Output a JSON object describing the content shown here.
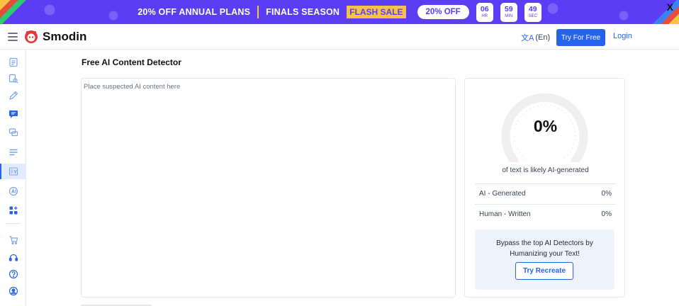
{
  "promo": {
    "headline": "20% OFF ANNUAL PLANS",
    "season": "FINALS SEASON",
    "flash": "FLASH SALE",
    "discount": "20% OFF",
    "timers": [
      {
        "value": "06",
        "unit": "HR"
      },
      {
        "value": "59",
        "unit": "MIN"
      },
      {
        "value": "49",
        "unit": "SEC"
      }
    ],
    "close": "X",
    "colors": {
      "background": "#5b3df5",
      "accent": "#f6c344"
    }
  },
  "header": {
    "brand": "Smodin",
    "language": "(En)",
    "try_free": "Try For Free",
    "login": "Login"
  },
  "sidebar": {
    "items": [
      {
        "icon": "document-check-icon"
      },
      {
        "icon": "document-search-icon"
      },
      {
        "icon": "pencil-icon"
      },
      {
        "icon": "chat-icon"
      },
      {
        "icon": "chat-bubbles-icon"
      },
      {
        "icon": "lines-icon"
      },
      {
        "icon": "ai-detector-icon",
        "active": true
      },
      {
        "icon": "ai-badge-icon"
      },
      {
        "icon": "apps-grid-icon"
      },
      {
        "icon": "cart-icon"
      },
      {
        "icon": "headset-icon"
      },
      {
        "icon": "help-circle-icon"
      },
      {
        "icon": "user-circle-icon"
      }
    ]
  },
  "main": {
    "title": "Free AI Content Detector",
    "editor_placeholder": "Place suspected AI content here"
  },
  "result": {
    "score": "0%",
    "score_fraction": 0,
    "caption": "of text is likely AI-generated",
    "rows": [
      {
        "label": "AI - Generated",
        "value": "0%"
      },
      {
        "label": "Human - Written",
        "value": "0%"
      }
    ],
    "promo_text": "Bypass the top AI Detectors by Humanizing your Text!",
    "recreate_button": "Try Recreate"
  }
}
